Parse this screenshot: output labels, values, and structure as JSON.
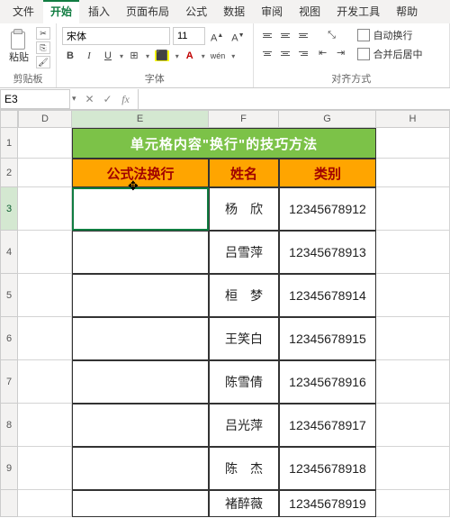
{
  "tabs": {
    "file": "文件",
    "home": "开始",
    "insert": "插入",
    "layout": "页面布局",
    "formula": "公式",
    "data": "数据",
    "review": "审阅",
    "view": "视图",
    "dev": "开发工具",
    "help": "帮助"
  },
  "ribbon": {
    "clipboard": {
      "paste": "粘贴",
      "label": "剪贴板"
    },
    "font": {
      "name": "宋体",
      "size": "11",
      "label": "字体",
      "bold": "B",
      "italic": "I",
      "underline": "U"
    },
    "align": {
      "label": "对齐方式",
      "wrap": "自动换行",
      "merge": "合并后居中"
    }
  },
  "namebox": "E3",
  "columns": [
    "D",
    "E",
    "F",
    "G",
    "H"
  ],
  "rows": [
    "1",
    "2",
    "3",
    "4",
    "5",
    "6",
    "7",
    "8",
    "9"
  ],
  "table": {
    "title": "单元格内容\"换行\"的技巧方法",
    "headers": {
      "e": "公式法换行",
      "f": "姓名",
      "g": "类别"
    },
    "data": [
      {
        "e": "",
        "f": "杨　欣",
        "g": "12345678912"
      },
      {
        "e": "",
        "f": "吕雪萍",
        "g": "12345678913"
      },
      {
        "e": "",
        "f": "桓　梦",
        "g": "12345678914"
      },
      {
        "e": "",
        "f": "王笑白",
        "g": "12345678915"
      },
      {
        "e": "",
        "f": "陈雪倩",
        "g": "12345678916"
      },
      {
        "e": "",
        "f": "吕光萍",
        "g": "12345678917"
      },
      {
        "e": "",
        "f": "陈　杰",
        "g": "12345678918"
      },
      {
        "e": "",
        "f": "褚醉薇",
        "g": "12345678919"
      }
    ]
  }
}
